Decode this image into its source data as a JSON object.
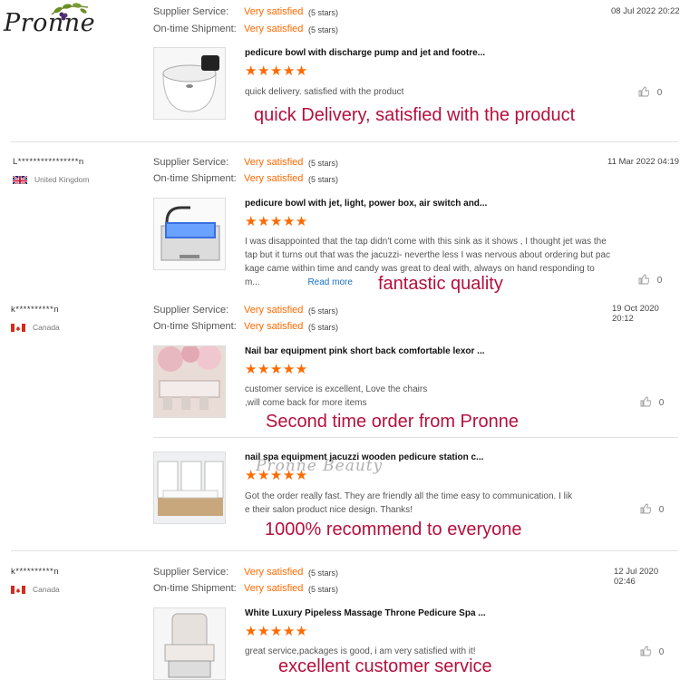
{
  "brand": {
    "logo_text": "Pronne"
  },
  "labels": {
    "supplier": "Supplier Service:",
    "ontime": "On-time Shipment:",
    "read_more": "Read more"
  },
  "watermark": "Pronne Beauty",
  "colors": {
    "accent": "#ff6a00",
    "note": "#b5103d",
    "link": "#1a6fc9"
  },
  "reviews": [
    {
      "user": "",
      "country": "",
      "date": "08 Jul 2022 20:22",
      "supplier_value": "Very satisfied",
      "supplier_stars": "(5 stars)",
      "ontime_value": "Very satisfied",
      "ontime_stars": "(5 stars)",
      "items": [
        {
          "title": "pedicure bowl with discharge pump and jet and footre...",
          "rating": 5,
          "stars": "★★★★★",
          "comment": "quick delivery.  satisfied with the product",
          "likes": "0",
          "note": "quick Delivery, satisfied with the product"
        }
      ]
    },
    {
      "user": "L****************n",
      "country": "United Kingdom",
      "date": "11 Mar 2022 04:19",
      "supplier_value": "Very satisfied",
      "supplier_stars": "(5 stars)",
      "ontime_value": "Very satisfied",
      "ontime_stars": "(5 stars)",
      "items": [
        {
          "title": "pedicure bowl with jet, light, power box, air switch and...",
          "rating": 5,
          "stars": "★★★★★",
          "comment": "I was disappointed that the tap didn't come with this sink as it shows , I thought jet was the tap but it turns out that was the jacuzzi- neverthe less I was nervous about ordering but package came within time and candy was great to deal with, always on hand responding to m...",
          "comment_line1": "I was disappointed that the tap didn't come with this sink as it shows , I thought jet was the",
          "comment_line2": "tap but it turns out that was the jacuzzi- neverthe less I was nervous about ordering but pac",
          "comment_line3": "kage came within time and candy was great to deal with, always on hand responding to",
          "comment_line4": "m...",
          "likes": "0",
          "note": "fantastic quality"
        }
      ]
    },
    {
      "user": "k**********n",
      "country": "Canada",
      "date": "19 Oct 2020 20:12",
      "supplier_value": "Very satisfied",
      "supplier_stars": "(5 stars)",
      "ontime_value": "Very satisfied",
      "ontime_stars": "(5 stars)",
      "items": [
        {
          "title": "Nail bar equipment pink short back comfortable lexor ...",
          "rating": 5,
          "stars": "★★★★★",
          "comment_line1": "customer service is excellent, Love the chairs",
          "comment_line2": ",will come back for more items",
          "likes": "0",
          "note": "Second time order from Pronne"
        },
        {
          "title": "nail spa equipment jacuzzi wooden pedicure station c...",
          "rating": 5,
          "stars": "★★★★★",
          "comment_line1": "Got the order really fast. They are friendly all the time easy to communication. I lik",
          "comment_line2": "e their salon product nice design. Thanks!",
          "likes": "0",
          "note": "1000% recommend to everyone"
        }
      ]
    },
    {
      "user": "k**********n",
      "country": "Canada",
      "date": "12 Jul 2020 02:46",
      "supplier_value": "Very satisfied",
      "supplier_stars": "(5 stars)",
      "ontime_value": "Very satisfied",
      "ontime_stars": "(5 stars)",
      "items": [
        {
          "title": "White Luxury Pipeless Massage Throne Pedicure Spa ...",
          "rating": 5,
          "stars": "★★★★★",
          "comment": "great service,packages is good, i am very satisfied with it!",
          "likes": "0",
          "note": "excellent customer service"
        }
      ]
    }
  ]
}
